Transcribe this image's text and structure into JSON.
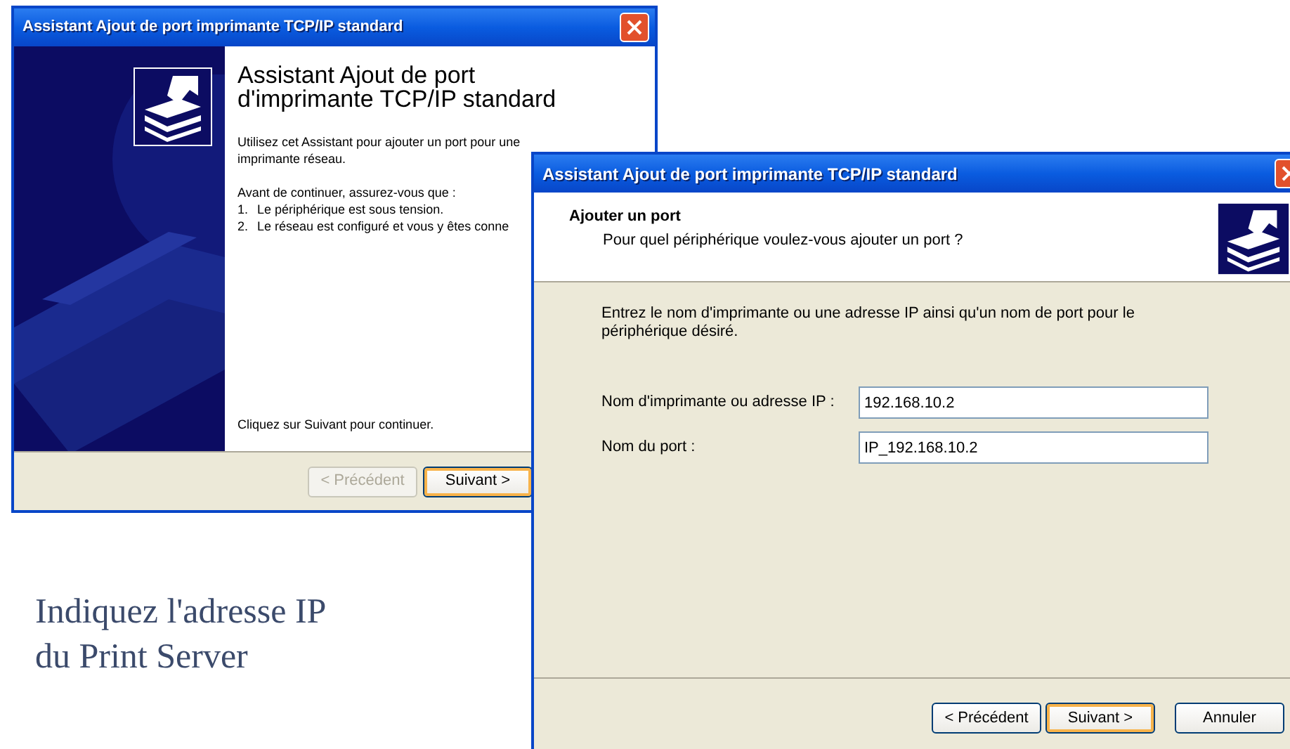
{
  "windows": [
    {
      "kind": "welcome",
      "title": "Assistant Ajout de port imprimante TCP/IP standard",
      "heading": "Assistant Ajout de port d'imprimante TCP/IP standard",
      "intro": "Utilisez cet Assistant pour ajouter un port pour une imprimante réseau.",
      "before": "Avant de continuer, assurez-vous que :",
      "steps": [
        {
          "number": "1.",
          "text": "Le périphérique est sous tension."
        },
        {
          "number": "2.",
          "text": "Le réseau est configuré et vous y êtes conne"
        }
      ],
      "footer": "Cliquez sur Suivant pour continuer.",
      "buttons": [
        {
          "label": "< Précédent",
          "disabled": true,
          "default": false
        },
        {
          "label": "Suivant >",
          "disabled": false,
          "default": true
        }
      ]
    },
    {
      "kind": "form",
      "title": "Assistant Ajout de port imprimante TCP/IP standard",
      "header_title": "Ajouter un port",
      "header_subtitle": "Pour quel périphérique voulez-vous ajouter un port ?",
      "instructions": "Entrez le nom d'imprimante ou une adresse IP ainsi qu'un nom de port pour le périphérique désiré.",
      "fields": [
        {
          "label": "Nom d'imprimante ou adresse IP :",
          "value": "192.168.10.2"
        },
        {
          "label": "Nom du port :",
          "value": "IP_192.168.10.2"
        }
      ],
      "buttons": [
        {
          "label": "< Précédent",
          "disabled": false,
          "default": false
        },
        {
          "label": "Suivant >",
          "disabled": false,
          "default": true
        },
        {
          "label": "Annuler",
          "disabled": false,
          "default": false
        }
      ]
    }
  ],
  "caption": [
    "Indiquez l'adresse IP",
    "du Print Server"
  ]
}
